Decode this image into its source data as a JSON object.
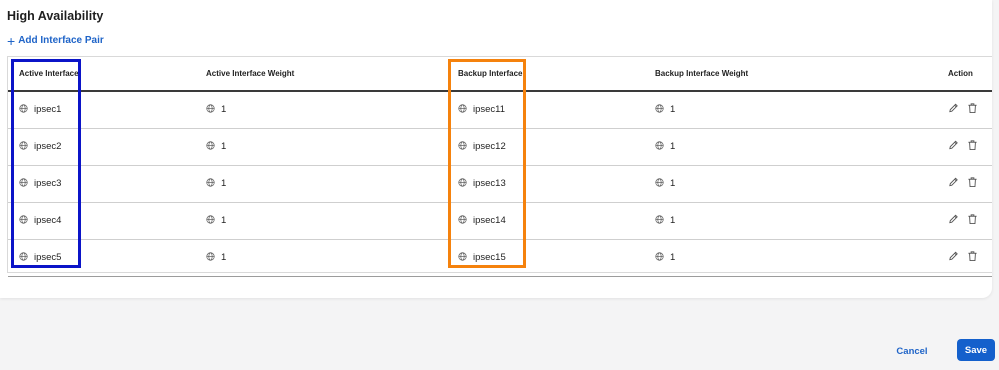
{
  "section": {
    "title": "High Availability",
    "add_link_label": "Add Interface Pair"
  },
  "table": {
    "headers": [
      "Active Interface",
      "Active Interface Weight",
      "Backup Interface",
      "Backup Interface Weight",
      "Action"
    ],
    "rows": [
      {
        "active": "ipsec1",
        "active_weight": "1",
        "backup": "ipsec11",
        "backup_weight": "1"
      },
      {
        "active": "ipsec2",
        "active_weight": "1",
        "backup": "ipsec12",
        "backup_weight": "1"
      },
      {
        "active": "ipsec3",
        "active_weight": "1",
        "backup": "ipsec13",
        "backup_weight": "1"
      },
      {
        "active": "ipsec4",
        "active_weight": "1",
        "backup": "ipsec14",
        "backup_weight": "1"
      },
      {
        "active": "ipsec5",
        "active_weight": "1",
        "backup": "ipsec15",
        "backup_weight": "1"
      }
    ]
  },
  "footer": {
    "cancel_label": "Cancel",
    "save_label": "Save"
  },
  "colors": {
    "accent": "#1f64c8",
    "save_bg": "#1460cc",
    "highlight_active": "#0b14c8",
    "highlight_backup": "#f5820d"
  },
  "icons": {
    "interface": "globe-icon",
    "edit": "pencil-icon",
    "delete": "trash-icon",
    "add": "plus-icon"
  }
}
